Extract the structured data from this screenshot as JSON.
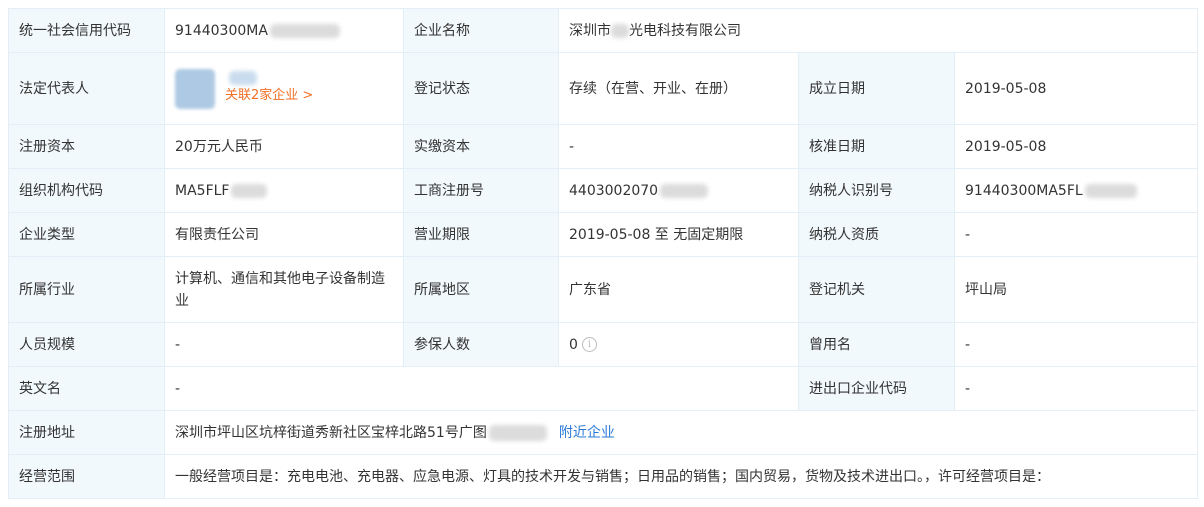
{
  "rows": {
    "credit_code": {
      "label": "统一社会信用代码",
      "value": "91440300MA"
    },
    "company_name": {
      "label": "企业名称",
      "value_prefix": "深圳市",
      "value_suffix": "光电科技有限公司"
    },
    "legal_rep": {
      "label": "法定代表人",
      "related_link": "关联2家企业 >"
    },
    "reg_status": {
      "label": "登记状态",
      "value": "存续（在营、开业、在册）"
    },
    "found_date": {
      "label": "成立日期",
      "value": "2019-05-08"
    },
    "reg_capital": {
      "label": "注册资本",
      "value": "20万元人民币"
    },
    "paid_capital": {
      "label": "实缴资本",
      "value": "-"
    },
    "approve_date": {
      "label": "核准日期",
      "value": "2019-05-08"
    },
    "org_code": {
      "label": "组织机构代码",
      "value": "MA5FLF"
    },
    "biz_reg_no": {
      "label": "工商注册号",
      "value": "4403002070"
    },
    "taxpayer_id": {
      "label": "纳税人识别号",
      "value": "91440300MA5FL"
    },
    "company_type": {
      "label": "企业类型",
      "value": "有限责任公司"
    },
    "biz_term": {
      "label": "营业期限",
      "value": "2019-05-08 至 无固定期限"
    },
    "taxpayer_qual": {
      "label": "纳税人资质",
      "value": "-"
    },
    "industry": {
      "label": "所属行业",
      "value": "计算机、通信和其他电子设备制造业"
    },
    "region": {
      "label": "所属地区",
      "value": "广东省"
    },
    "reg_authority": {
      "label": "登记机关",
      "value": "坪山局"
    },
    "staff_size": {
      "label": "人员规模",
      "value": "-"
    },
    "insured": {
      "label": "参保人数",
      "value": "0"
    },
    "former_name": {
      "label": "曾用名",
      "value": "-"
    },
    "english_name": {
      "label": "英文名",
      "value": "-"
    },
    "import_export": {
      "label": "进出口企业代码",
      "value": "-"
    },
    "reg_address": {
      "label": "注册地址",
      "value": "深圳市坪山区坑梓街道秀新社区宝梓北路51号广图",
      "nearby_link": "附近企业"
    },
    "biz_scope": {
      "label": "经营范围",
      "value": "一般经营项目是：充电电池、充电器、应急电源、灯具的技术开发与销售；日用品的销售；国内贸易，货物及技术进出口。，许可经营项目是："
    }
  },
  "icons": {
    "info": "info-icon"
  },
  "colors": {
    "label_bg": "#f2f9fc",
    "border": "#e4eef6",
    "link_orange": "#f06f26",
    "link_blue": "#2c7ad6"
  }
}
